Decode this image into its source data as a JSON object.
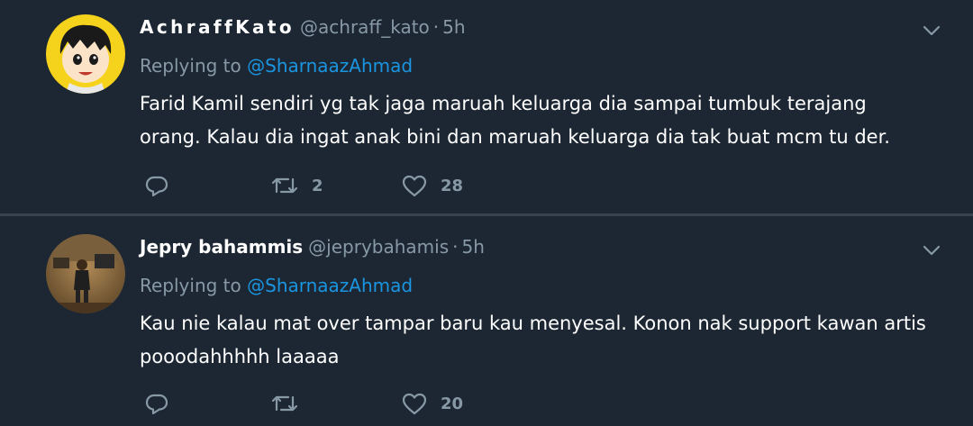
{
  "tweets": [
    {
      "display_name": "AchraffKato",
      "handle": "@achraff_kato",
      "separator": "·",
      "time": "5h",
      "replying_prefix": "Replying to",
      "replying_to": "@SharnaazAhmad",
      "text": "Farid Kamil sendiri yg tak jaga maruah keluarga dia sampai tumbuk terajang orang. Kalau dia ingat anak bini dan maruah keluarga dia tak buat mcm tu der.",
      "retweets": "2",
      "likes": "28"
    },
    {
      "display_name": "Jepry bahammis",
      "handle": "@jeprybahamis",
      "separator": "·",
      "time": "5h",
      "replying_prefix": "Replying to",
      "replying_to": "@SharnaazAhmad",
      "text": "Kau nie kalau mat over tampar baru kau menyesal. Konon nak support kawan artis pooodahhhhh laaaaa",
      "retweets": "",
      "likes": "20"
    }
  ],
  "icons": {
    "reply": "reply-icon",
    "retweet": "retweet-icon",
    "like": "heart-icon",
    "more": "chevron-down-icon"
  },
  "colors": {
    "background": "#1c2733",
    "divider": "#38444d",
    "secondary_text": "#8899a6",
    "link": "#1b95e0",
    "primary_text": "#ffffff"
  }
}
